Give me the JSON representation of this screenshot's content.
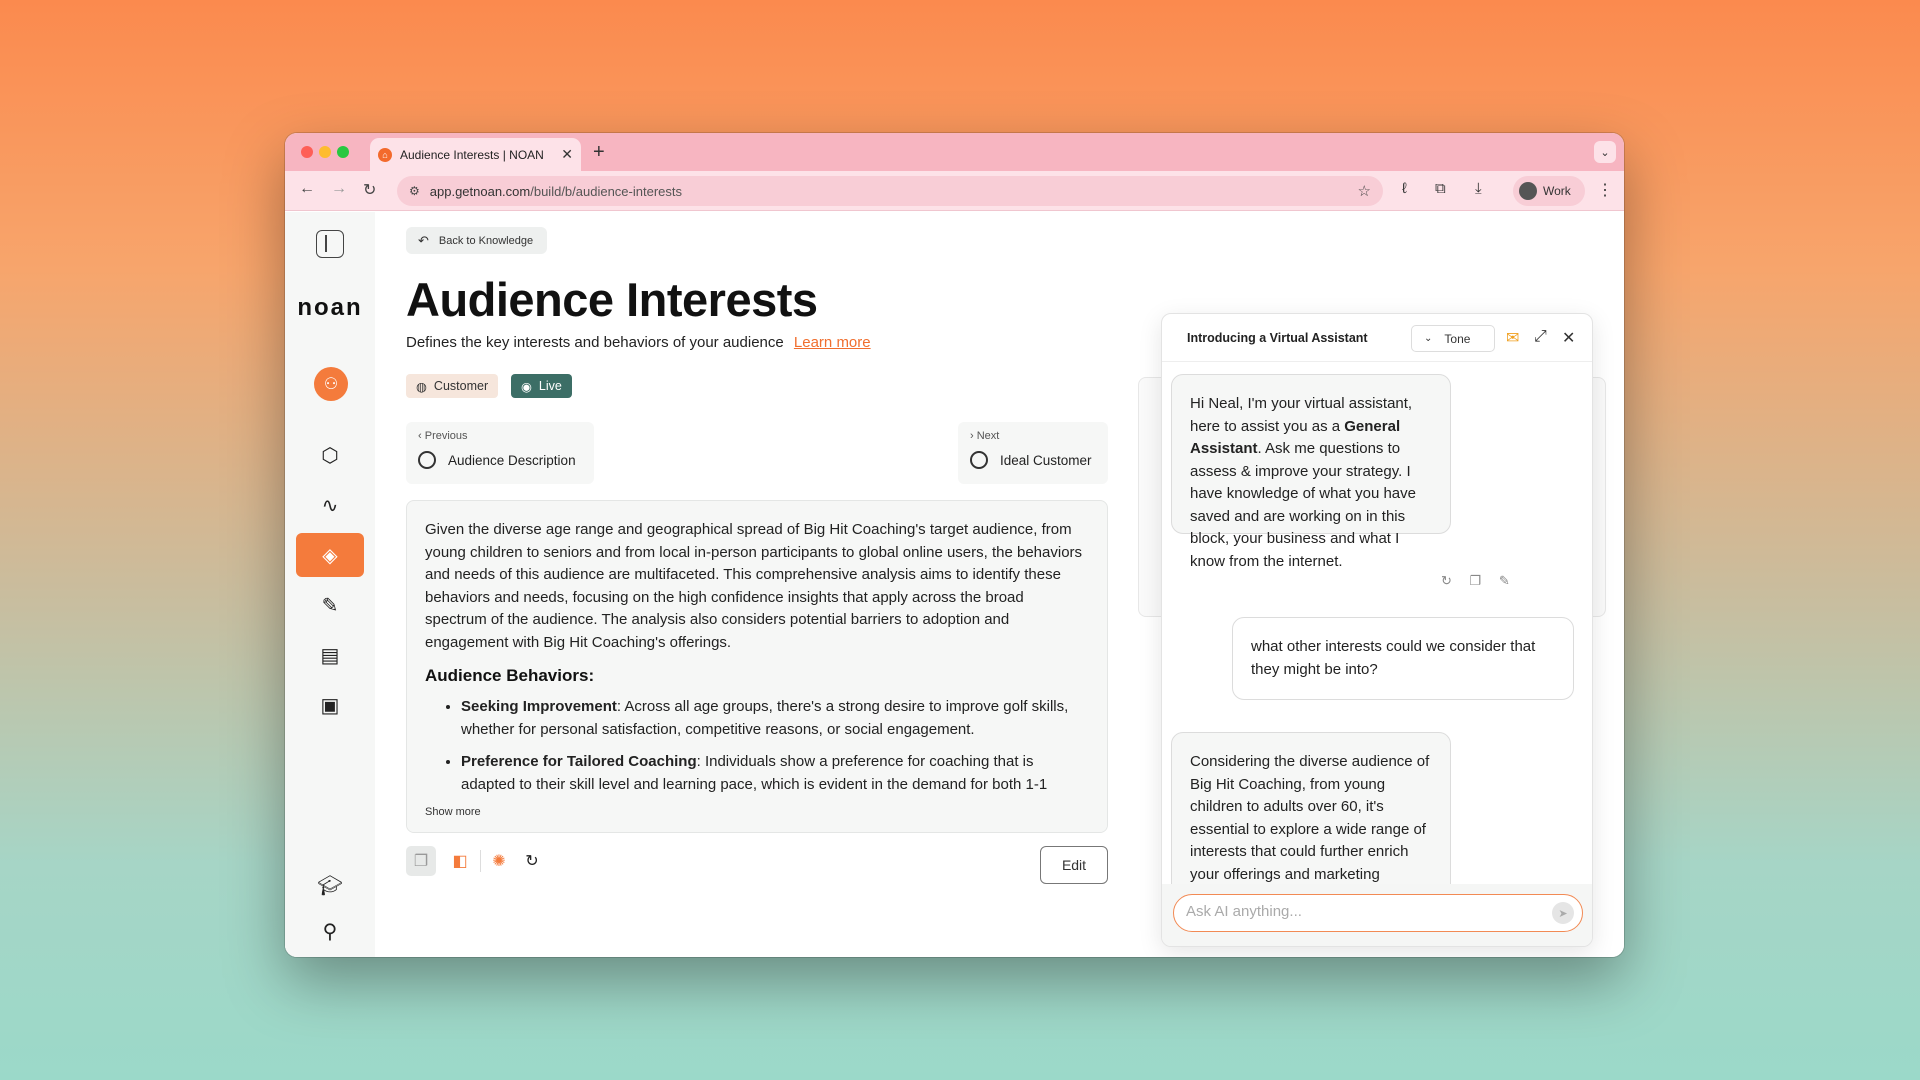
{
  "browser": {
    "tab_title": "Audience Interests | NOAN",
    "url_host": "app.getnoan.com",
    "url_path": "/build/b/audience-interests",
    "profile_label": "Work",
    "tab_close": "✕",
    "new_tab": "+",
    "tab_menu": "⌄"
  },
  "sidebar": {
    "logo": "noan"
  },
  "main": {
    "back_label": "Back to Knowledge",
    "title": "Audience Interests",
    "subtitle": "Defines the key interests and behaviors of your audience",
    "learn_more": "Learn more",
    "chips": {
      "customer": "Customer",
      "live": "Live"
    },
    "previous": {
      "label": "Previous",
      "name": "Audience Description"
    },
    "next": {
      "label": "Next",
      "name": "Ideal Customer"
    },
    "body_paragraph": "Given the diverse age range and geographical spread of Big Hit Coaching's target audience, from young children to seniors and from local in-person participants to global online users, the behaviors and needs of this audience are multifaceted. This comprehensive analysis aims to identify these behaviors and needs, focusing on the high confidence insights that apply across the broad spectrum of the audience. The analysis also considers potential barriers to adoption and engagement with Big Hit Coaching's offerings.",
    "section_heading": "Audience Behaviors:",
    "bullets": [
      {
        "bold": "Seeking Improvement",
        "text": ": Across all age groups, there's a strong desire to improve golf skills, whether for personal satisfaction, competitive reasons, or social engagement."
      },
      {
        "bold": "Preference for Tailored Coaching",
        "text": ": Individuals show a preference for coaching that is adapted to their skill level and learning pace, which is evident in the demand for both 1-1"
      }
    ],
    "show_more": "Show more",
    "edit_label": "Edit"
  },
  "chat": {
    "title": "Introducing a Virtual Assistant",
    "tone_label": "Tone",
    "assistant_msg_1_pre": "Hi Neal, I'm your virtual assistant, here to assist you as a ",
    "assistant_msg_1_bold": "General Assistant",
    "assistant_msg_1_post": ". Ask me questions to assess & improve your strategy. I have knowledge of what you have saved and are working on in this block, your business and what I know from the internet.",
    "user_msg": "what other interests could we consider that they might be into?",
    "assistant_msg_2": "Considering the diverse audience of Big Hit Coaching, from young children to adults over 60, it's essential to explore a wide range of interests that could further enrich your offerings and marketing strategies. Here are additional interests to consider:",
    "input_placeholder": "Ask AI anything..."
  },
  "colors": {
    "accent": "#f47b3c",
    "live_chip": "#3c6e66",
    "browser_frame": "#f7b5c1"
  }
}
